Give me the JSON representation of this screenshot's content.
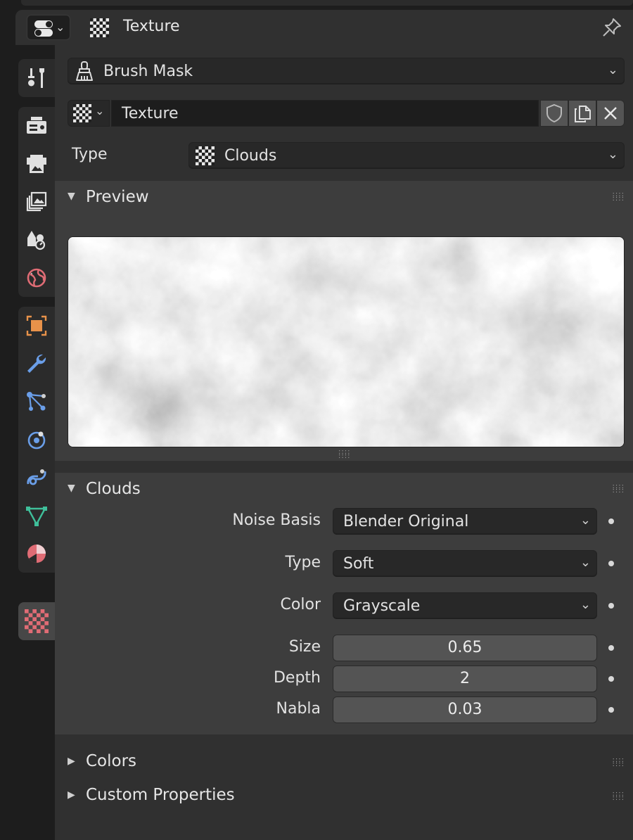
{
  "header": {
    "title": "Texture",
    "editor_type_icon": "properties-editor-icon",
    "title_icon": "checker-texture-icon",
    "pin_icon": "pin-icon"
  },
  "tabs": [
    {
      "name": "tool",
      "icon": "tool-icon"
    },
    {
      "name": "render",
      "icon": "render-icon"
    },
    {
      "name": "output",
      "icon": "output-icon"
    },
    {
      "name": "view-layer",
      "icon": "view-layer-icon"
    },
    {
      "name": "scene",
      "icon": "scene-icon"
    },
    {
      "name": "world",
      "icon": "world-icon"
    },
    {
      "name": "object",
      "icon": "object-icon"
    },
    {
      "name": "modifiers",
      "icon": "wrench-icon"
    },
    {
      "name": "particles",
      "icon": "particles-icon"
    },
    {
      "name": "physics",
      "icon": "physics-icon"
    },
    {
      "name": "constraints",
      "icon": "constraints-icon"
    },
    {
      "name": "data",
      "icon": "mesh-data-icon"
    },
    {
      "name": "material",
      "icon": "material-icon"
    },
    {
      "name": "texture",
      "icon": "texture-icon",
      "active": true
    }
  ],
  "context": {
    "selected": "Brush Mask"
  },
  "texture_block": {
    "name": "Texture"
  },
  "type_row": {
    "label": "Type",
    "value": "Clouds"
  },
  "preview_panel": {
    "title": "Preview"
  },
  "clouds_panel": {
    "title": "Clouds",
    "noise_basis": {
      "label": "Noise Basis",
      "value": "Blender Original"
    },
    "type": {
      "label": "Type",
      "value": "Soft"
    },
    "color": {
      "label": "Color",
      "value": "Grayscale"
    },
    "size": {
      "label": "Size",
      "value": "0.65"
    },
    "depth": {
      "label": "Depth",
      "value": "2"
    },
    "nabla": {
      "label": "Nabla",
      "value": "0.03"
    }
  },
  "colors_panel": {
    "title": "Colors"
  },
  "custom_properties_panel": {
    "title": "Custom Properties"
  },
  "colors": {
    "active_tab": "#474747",
    "texture_icon": "#e06c75",
    "object_icon": "#e8924a",
    "modifier_icon": "#6a9ee8",
    "mesh_icon": "#3fbf9a"
  }
}
